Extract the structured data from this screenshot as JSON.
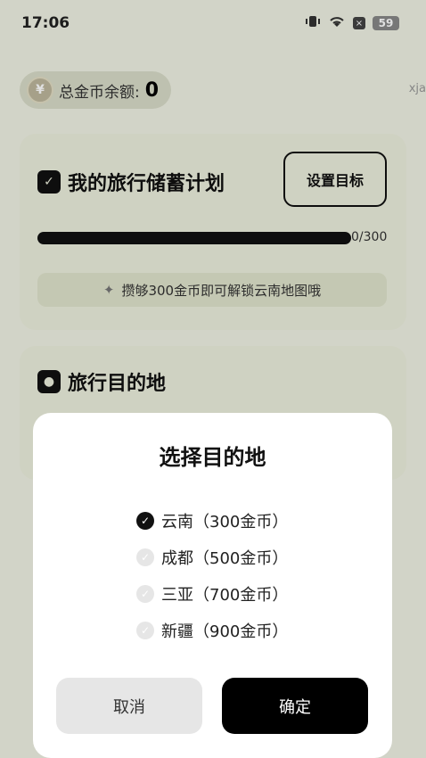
{
  "status_bar": {
    "time": "17:06",
    "battery": "59",
    "x_badge": "×"
  },
  "balance": {
    "coin_symbol": "¥",
    "label": "总金币余额:",
    "value": "0"
  },
  "edge_text": "xja",
  "plan_card": {
    "title": "我的旅行储蓄计划",
    "set_goal_label": "设置目标",
    "progress_text": "0/300",
    "progress_value": 0,
    "progress_max": 300,
    "hint": "攒够300金币即可解锁云南地图哦"
  },
  "destination_card": {
    "title": "旅行目的地"
  },
  "dialog": {
    "title": "选择目的地",
    "options": [
      {
        "label": "云南（300金币）",
        "selected": true
      },
      {
        "label": "成都（500金币）",
        "selected": false
      },
      {
        "label": "三亚（700金币）",
        "selected": false
      },
      {
        "label": "新疆（900金币）",
        "selected": false
      }
    ],
    "cancel_label": "取消",
    "confirm_label": "确定"
  },
  "colors": {
    "accent": "#000000",
    "background": "#f0f2e4",
    "card": "#ecefdd"
  }
}
